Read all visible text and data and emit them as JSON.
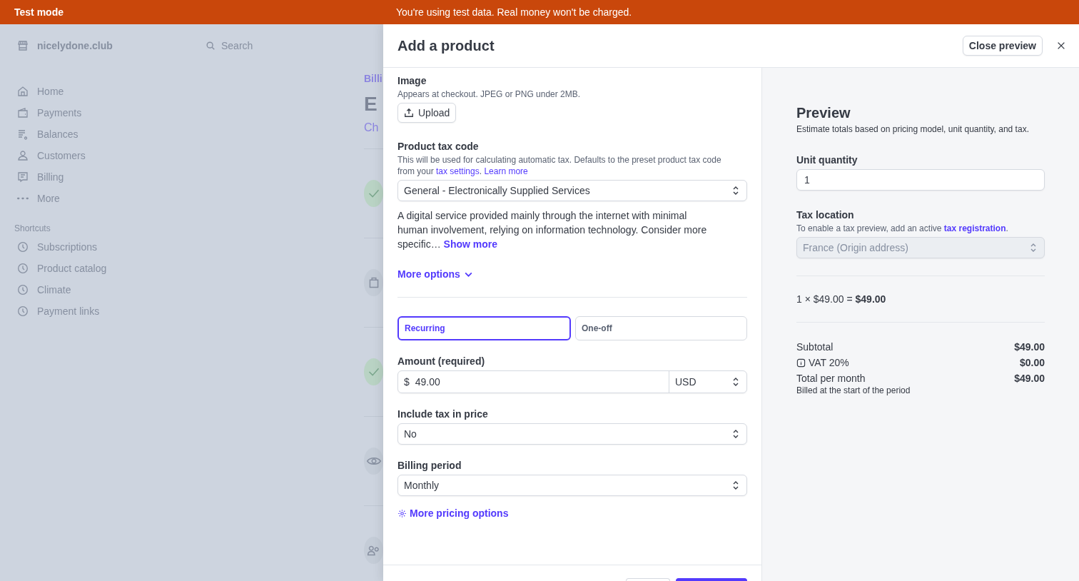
{
  "banner": {
    "label": "Test mode",
    "message": "You're using test data. Real money won't be charged."
  },
  "background": {
    "workspace": "nicelydone.club",
    "search_placeholder": "Search",
    "nav": [
      {
        "label": "Home",
        "kind": "home"
      },
      {
        "label": "Payments",
        "kind": "wallet"
      },
      {
        "label": "Balances",
        "kind": "balances"
      },
      {
        "label": "Customers",
        "kind": "person"
      },
      {
        "label": "Billing",
        "kind": "receipt"
      },
      {
        "label": "More",
        "kind": "dots"
      }
    ],
    "shortcuts_heading": "Shortcuts",
    "shortcuts": [
      {
        "label": "Subscriptions"
      },
      {
        "label": "Product catalog"
      },
      {
        "label": "Climate"
      },
      {
        "label": "Payment links"
      }
    ],
    "page": {
      "breadcrumb": "Billi",
      "title": "E",
      "link": "Ch"
    },
    "steps": [
      {
        "kind": "check"
      },
      {
        "kind": "bag"
      },
      {
        "kind": "check"
      },
      {
        "kind": "eye"
      },
      {
        "kind": "people"
      }
    ]
  },
  "drawer": {
    "title": "Add a product",
    "close_preview": "Close preview",
    "image": {
      "label": "Image",
      "hint": "Appears at checkout. JPEG or PNG under 2MB.",
      "upload": "Upload"
    },
    "tax_code": {
      "label": "Product tax code",
      "hint": "This will be used for calculating automatic tax. Defaults to the preset product tax code from your",
      "hint_link": "tax settings",
      "hint_after": ".",
      "learn_more": "Learn more",
      "value": "General - Electronically Supplied Services",
      "description": "A digital service provided mainly through the internet with minimal human involvement, relying on information technology. Consider more specific…",
      "show_more": "Show more"
    },
    "more_options": "More options",
    "price_types": [
      {
        "label": "Recurring",
        "selected": true
      },
      {
        "label": "One-off",
        "selected": false
      }
    ],
    "amount": {
      "label": "Amount (required)",
      "symbol": "$",
      "value": "49.00",
      "currency": "USD"
    },
    "include_tax": {
      "label": "Include tax in price",
      "value": "No"
    },
    "billing_period": {
      "label": "Billing period",
      "value": "Monthly"
    },
    "more_pricing": "More pricing options"
  },
  "preview": {
    "title": "Preview",
    "subtitle": "Estimate totals based on pricing model, unit quantity, and tax.",
    "unit_quantity": {
      "label": "Unit quantity",
      "value": "1"
    },
    "tax_location": {
      "label": "Tax location",
      "hint": "To enable a tax preview, add an active",
      "link": "tax registration",
      "hint_after": ".",
      "value": "France (Origin address)",
      "disabled": true
    },
    "calculation": "1 × $49.00 = **$49.00**",
    "summary": [
      {
        "label": "Subtotal",
        "value": "$49.00",
        "kind": "plain"
      },
      {
        "label": "VAT 20%",
        "value": "$0.00",
        "kind": "info"
      },
      {
        "label": "Total per month",
        "value": "$49.00",
        "kind": "plain"
      }
    ],
    "note": "Billed at the start of the period"
  }
}
